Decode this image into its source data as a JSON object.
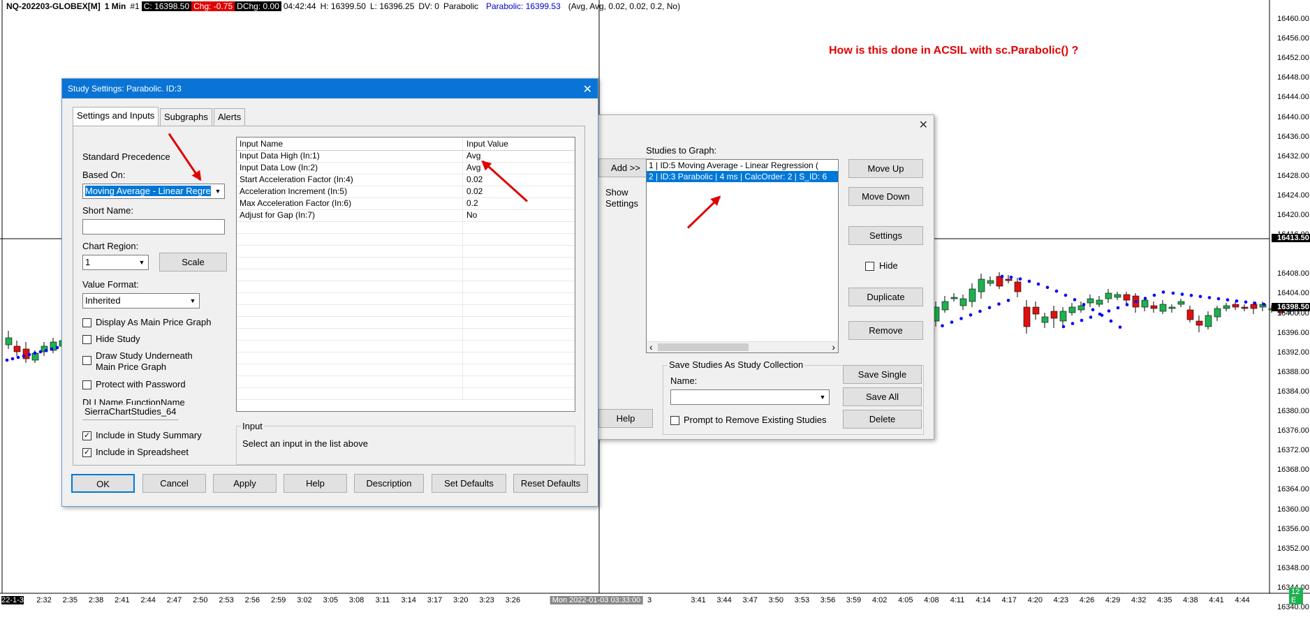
{
  "chart_header": {
    "symbol": "NQ-202203-GLOBEX[M]",
    "interval": "1 Min",
    "chart_number": "#1",
    "close": "C: 16398.50",
    "change": "Chg: -0.75",
    "dchange": "DChg: 0.00",
    "time": "04:42:44",
    "high": "H: 16399.50",
    "low": "L: 16396.25",
    "dv": "DV: 0",
    "study_name": "Parabolic",
    "study_value": "Parabolic: 16399.53",
    "study_params": "(Avg, Avg, 0.02, 0.02, 0.2, No)"
  },
  "question": "How is this done in ACSIL with sc.Parabolic() ?",
  "price_scale": [
    "16460.00",
    "16456.00",
    "16452.00",
    "16448.00",
    "16444.00",
    "16440.00",
    "16436.00",
    "16432.00",
    "16428.00",
    "16424.00",
    "16420.00",
    "16416.00",
    "16413.50",
    "16408.00",
    "16404.00",
    "16400.00",
    "16398.50",
    "16396.00",
    "16392.00",
    "16388.00",
    "16384.00",
    "16380.00",
    "16376.00",
    "16372.00",
    "16368.00",
    "16364.00",
    "16360.00",
    "16356.00",
    "16352.00",
    "16348.00",
    "16344.00",
    "16340.00"
  ],
  "time_scale": [
    "22-1-3",
    "2:32",
    "2:35",
    "2:38",
    "2:41",
    "2:44",
    "2:47",
    "2:50",
    "2:53",
    "2:56",
    "2:59",
    "3:02",
    "3:05",
    "3:08",
    "3:11",
    "3:14",
    "3:17",
    "3:20",
    "3:23",
    "3:26",
    "Mon 2022-01-03  03:33:00",
    "3",
    "3:41",
    "3:44",
    "3:47",
    "3:50",
    "3:53",
    "3:56",
    "3:59",
    "4:02",
    "4:05",
    "4:08",
    "4:11",
    "4:14",
    "4:17",
    "4:20",
    "4:23",
    "4:26",
    "4:29",
    "4:32",
    "4:35",
    "4:38",
    "4:41",
    "4:44"
  ],
  "time_corner": "12 E",
  "study_settings": {
    "title": "Study Settings: Parabolic. ID:3",
    "close": "✕",
    "tabs": [
      "Settings and Inputs",
      "Subgraphs",
      "Alerts"
    ],
    "standard_precedence": "Standard Precedence",
    "based_on_label": "Based On:",
    "based_on_value": "Moving Average - Linear Regre",
    "short_name_label": "Short Name:",
    "short_name_value": "",
    "chart_region_label": "Chart Region:",
    "chart_region_value": "1",
    "scale_button": "Scale",
    "value_format_label": "Value Format:",
    "value_format_value": "Inherited",
    "checkboxes": [
      {
        "label": "Display As Main Price Graph",
        "checked": ""
      },
      {
        "label": "Hide Study",
        "checked": ""
      },
      {
        "label": "Draw Study Underneath",
        "checked": ""
      },
      {
        "label": "Protect with Password",
        "checked": ""
      }
    ],
    "draw_underneath_line2": "Main Price Graph",
    "dll_label": "DLLName.FunctionName",
    "dll_value": "SierraChartStudies_64",
    "include_summary": {
      "label": "Include in Study Summary",
      "checked": "✓"
    },
    "include_spreadsheet": {
      "label": "Include in Spreadsheet",
      "checked": "✓"
    },
    "inputs_header": {
      "name": "Input Name",
      "value": "Input Value"
    },
    "inputs": [
      {
        "name": "Input Data High   (In:1)",
        "value": "Avg"
      },
      {
        "name": "Input Data Low   (In:2)",
        "value": "Avg"
      },
      {
        "name": "Start Acceleration Factor  (In:4)",
        "value": "0.02"
      },
      {
        "name": "Acceleration Increment  (In:5)",
        "value": "0.02"
      },
      {
        "name": "Max Acceleration Factor  (In:6)",
        "value": "0.2"
      },
      {
        "name": "Adjust for Gap  (In:7)",
        "value": "No"
      }
    ],
    "input_group_label": "Input",
    "input_hint": "Select an input in the list above",
    "buttons": [
      "OK",
      "Cancel",
      "Apply",
      "Help",
      "Description",
      "Set Defaults",
      "Reset Defaults"
    ]
  },
  "studies_dialog": {
    "close": "✕",
    "add_button": "Add >>",
    "show_settings": "Show Settings",
    "studies_label": "Studies to Graph:",
    "studies": [
      "1 | ID:5  Moving Average - Linear Regression (",
      "2 | ID:3  Parabolic | 4 ms | CalcOrder: 2 | S_ID: 6"
    ],
    "move_up": "Move Up",
    "move_down": "Move Down",
    "settings": "Settings",
    "hide": "Hide",
    "duplicate": "Duplicate",
    "remove": "Remove",
    "help": "Help",
    "collection_group": "Save Studies As Study Collection",
    "name_label": "Name:",
    "save_single": "Save Single",
    "save_all": "Save All",
    "delete": "Delete",
    "prompt_remove": "Prompt to Remove Existing Studies",
    "scroll_left": "‹",
    "scroll_right": "›"
  },
  "colors": {
    "bull": "#1fb050",
    "bear": "#e01010",
    "parabolic": "#0000ff",
    "accent": "#0078d7",
    "title_bar": "#0a74d6"
  }
}
